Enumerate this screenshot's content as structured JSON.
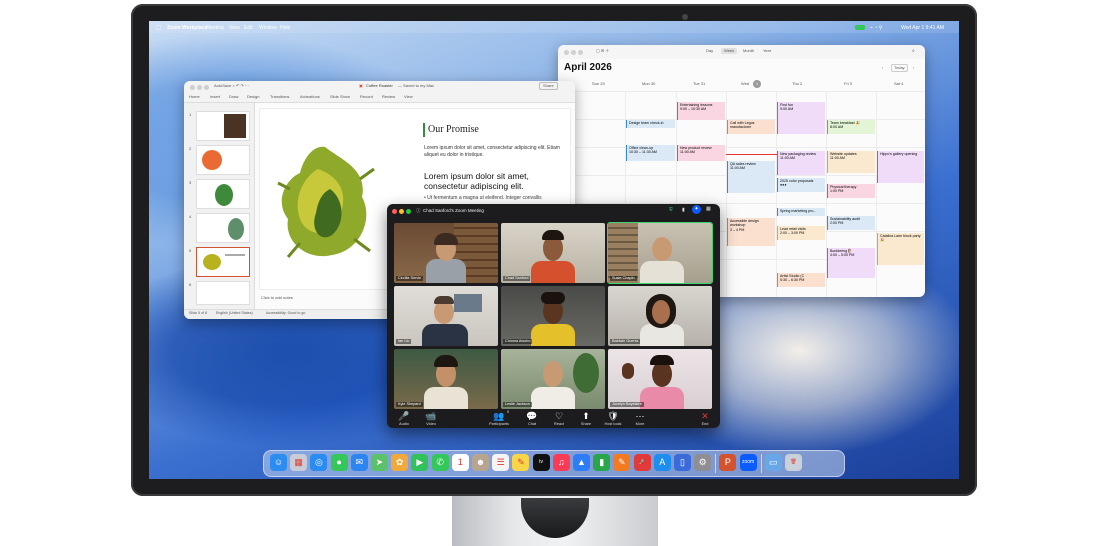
{
  "menubar": {
    "app_name": "Zoom Workplace",
    "items": [
      "Meeting",
      "View",
      "Edit",
      "Window",
      "Help"
    ],
    "clock": "Wed Apr 1  9:41 AM"
  },
  "calendar": {
    "title": "April 2026",
    "views": [
      "Day",
      "Week",
      "Month",
      "Year"
    ],
    "selected_view": "Week",
    "today_label": "Today",
    "days": [
      "Sun 29",
      "Mon 30",
      "Tue 31",
      "Wed",
      "Thu 2",
      "Fri 3",
      "Sat 4"
    ],
    "wed_badge": "1",
    "events": [
      {
        "title": "Entertaining lessons",
        "time": "9:00 – 10:30 AM",
        "color": "#f3b6c9"
      },
      {
        "title": "Design team check-in",
        "time": "",
        "color": "#cde3f7"
      },
      {
        "title": "Call with Legos manufacturer",
        "time": "",
        "color": "#f7c9b0"
      },
      {
        "title": "Office clean-up",
        "time": "10:30 – 11:30 AM",
        "color": "#cde3f7"
      },
      {
        "title": "New product review",
        "time": "11:00 AM",
        "color": "#f3b6c9"
      },
      {
        "title": "QA sales review",
        "time": "11:00 AM",
        "color": "#cde3f7"
      },
      {
        "title": "Find fun",
        "time": "9:00 AM",
        "color": "#e7c8f3"
      },
      {
        "title": "New packaging review",
        "time": "11:00 AM",
        "color": "#e7c8f3"
      },
      {
        "title": "2025 color proposals",
        "time": "",
        "color": "#cde3f7"
      },
      {
        "title": "Spring marketing pro...",
        "time": "",
        "color": "#cde3f7"
      },
      {
        "title": "Lead retail visits",
        "time": "2:00 – 3:00 PM",
        "color": "#f7dcb0"
      },
      {
        "title": "Accessible design workshop",
        "time": "3 – 4 PM",
        "color": "#f7c9b0"
      },
      {
        "title": "Artist Studio (C",
        "time": "5:30 – 6:30 PM",
        "color": "#f7c9b0"
      },
      {
        "title": "Team breakfast 🎉",
        "time": "8:00 AM",
        "color": "#d6f0c4"
      },
      {
        "title": "Website updates",
        "time": "11:00 AM",
        "color": "#f7dcb0"
      },
      {
        "title": "Physical therapy",
        "time": "1:00 PM",
        "color": "#f3b6c9"
      },
      {
        "title": "Sustainability audit",
        "time": "2:00 PM",
        "color": "#cde3f7"
      },
      {
        "title": "Bouldering 🧗",
        "time": "4:00 – 5:00 PM",
        "color": "#e7c8f3"
      },
      {
        "title": "Hippo's gallery opening",
        "time": "",
        "color": "#e7c8f3"
      },
      {
        "title": "Catalina Lane block party 🎉",
        "time": "",
        "color": "#f7dcb0"
      }
    ]
  },
  "ppt": {
    "file_name": "Coffee Roaster",
    "saved_status": "— Saved to my Mac",
    "share_label": "Share",
    "ribbon_tabs": [
      "Home",
      "Insert",
      "Draw",
      "Design",
      "Transitions",
      "Animations",
      "Slide Show",
      "Record",
      "Review",
      "View"
    ],
    "slide_heading": "Our Promise",
    "slide_body_small": "Lorem ipsum dolor sit amet, consectetur adipiscing elit. Etiam aliquet eu dolor in tristique.",
    "slide_body_large": "Lorem ipsum dolor sit amet, consectetur adipiscing elit.",
    "slide_bullet": "Ut fermentum a magna ut eleifend. Integer convallis",
    "notes_placeholder": "Click to add notes",
    "status_slide": "Slide 5 of 8",
    "status_lang": "English (United States)",
    "status_access": "Accessibility: Good to go",
    "slide_numbers": [
      "1",
      "2",
      "3",
      "4",
      "5",
      "6"
    ],
    "selected_slide": "5"
  },
  "zoom": {
    "title": "Chad Sanford's Zoom Meeting",
    "participants": [
      "Cecilia Servin",
      "Chad Sanford",
      "Susie Chapin",
      "Ian Liu",
      "Chioma Awobo",
      "Baldwin Guerra",
      "Kyle Shepard",
      "Leslie Jackson",
      "Jocelyn Bayelaire"
    ],
    "controls": [
      {
        "label": "Audio",
        "icon": "🎤"
      },
      {
        "label": "Video",
        "icon": "📹"
      },
      {
        "label": "Participants",
        "icon": "👥"
      },
      {
        "label": "Chat",
        "icon": "💬"
      },
      {
        "label": "React",
        "icon": "♡"
      },
      {
        "label": "Share",
        "icon": "⬆"
      },
      {
        "label": "Host tools",
        "icon": "🛡"
      },
      {
        "label": "More",
        "icon": "⋯"
      },
      {
        "label": "End",
        "icon": "✕"
      }
    ],
    "participant_count": "9",
    "colors": {
      "end": "#e5373a",
      "accent": "#0b5cff"
    }
  },
  "dock": {
    "apps": [
      {
        "name": "finder-icon",
        "glyph": "☺",
        "color": "#2d8cf0"
      },
      {
        "name": "launchpad-icon",
        "glyph": "▦",
        "color": "#c9ccd6"
      },
      {
        "name": "safari-icon",
        "glyph": "◎",
        "color": "#2a8bf2"
      },
      {
        "name": "messages-icon",
        "glyph": "●",
        "color": "#35c759"
      },
      {
        "name": "mail-icon",
        "glyph": "✉",
        "color": "#2d86f0"
      },
      {
        "name": "maps-icon",
        "glyph": "➤",
        "color": "#5bc26a"
      },
      {
        "name": "photos-icon",
        "glyph": "✿",
        "color": "#f2a93b"
      },
      {
        "name": "facetime-icon",
        "glyph": "▶",
        "color": "#32c25a"
      },
      {
        "name": "phone-icon",
        "glyph": "✆",
        "color": "#34c759"
      },
      {
        "name": "calendar-icon",
        "glyph": "1",
        "color": "#ffffff"
      },
      {
        "name": "contacts-icon",
        "glyph": "☻",
        "color": "#b8a58f"
      },
      {
        "name": "reminders-icon",
        "glyph": "☰",
        "color": "#f4f4f4"
      },
      {
        "name": "notes-icon",
        "glyph": "✎",
        "color": "#f8d648"
      },
      {
        "name": "appletv-icon",
        "glyph": "tv",
        "color": "#111111"
      },
      {
        "name": "music-icon",
        "glyph": "♫",
        "color": "#fb3b55"
      },
      {
        "name": "keynote-icon",
        "glyph": "▲",
        "color": "#2f7df6"
      },
      {
        "name": "numbers-icon",
        "glyph": "▮",
        "color": "#29a64a"
      },
      {
        "name": "pages-icon",
        "glyph": "✎",
        "color": "#f47a21"
      },
      {
        "name": "rocket-icon",
        "glyph": "🚀",
        "color": "#e23a3a"
      },
      {
        "name": "appstore-icon",
        "glyph": "A",
        "color": "#1d8df0"
      },
      {
        "name": "iphone-mirroring-icon",
        "glyph": "▯",
        "color": "#3b6bd8"
      },
      {
        "name": "settings-icon",
        "glyph": "⚙",
        "color": "#8e8e93"
      },
      {
        "name": "powerpoint-icon",
        "glyph": "P",
        "color": "#d35230"
      },
      {
        "name": "zoom-icon",
        "glyph": "zoom",
        "color": "#0b5cff"
      },
      {
        "name": "downloads-folder-icon",
        "glyph": "▭",
        "color": "#69a8e8"
      },
      {
        "name": "trash-icon",
        "glyph": "🗑",
        "color": "#c8d0da"
      }
    ]
  }
}
